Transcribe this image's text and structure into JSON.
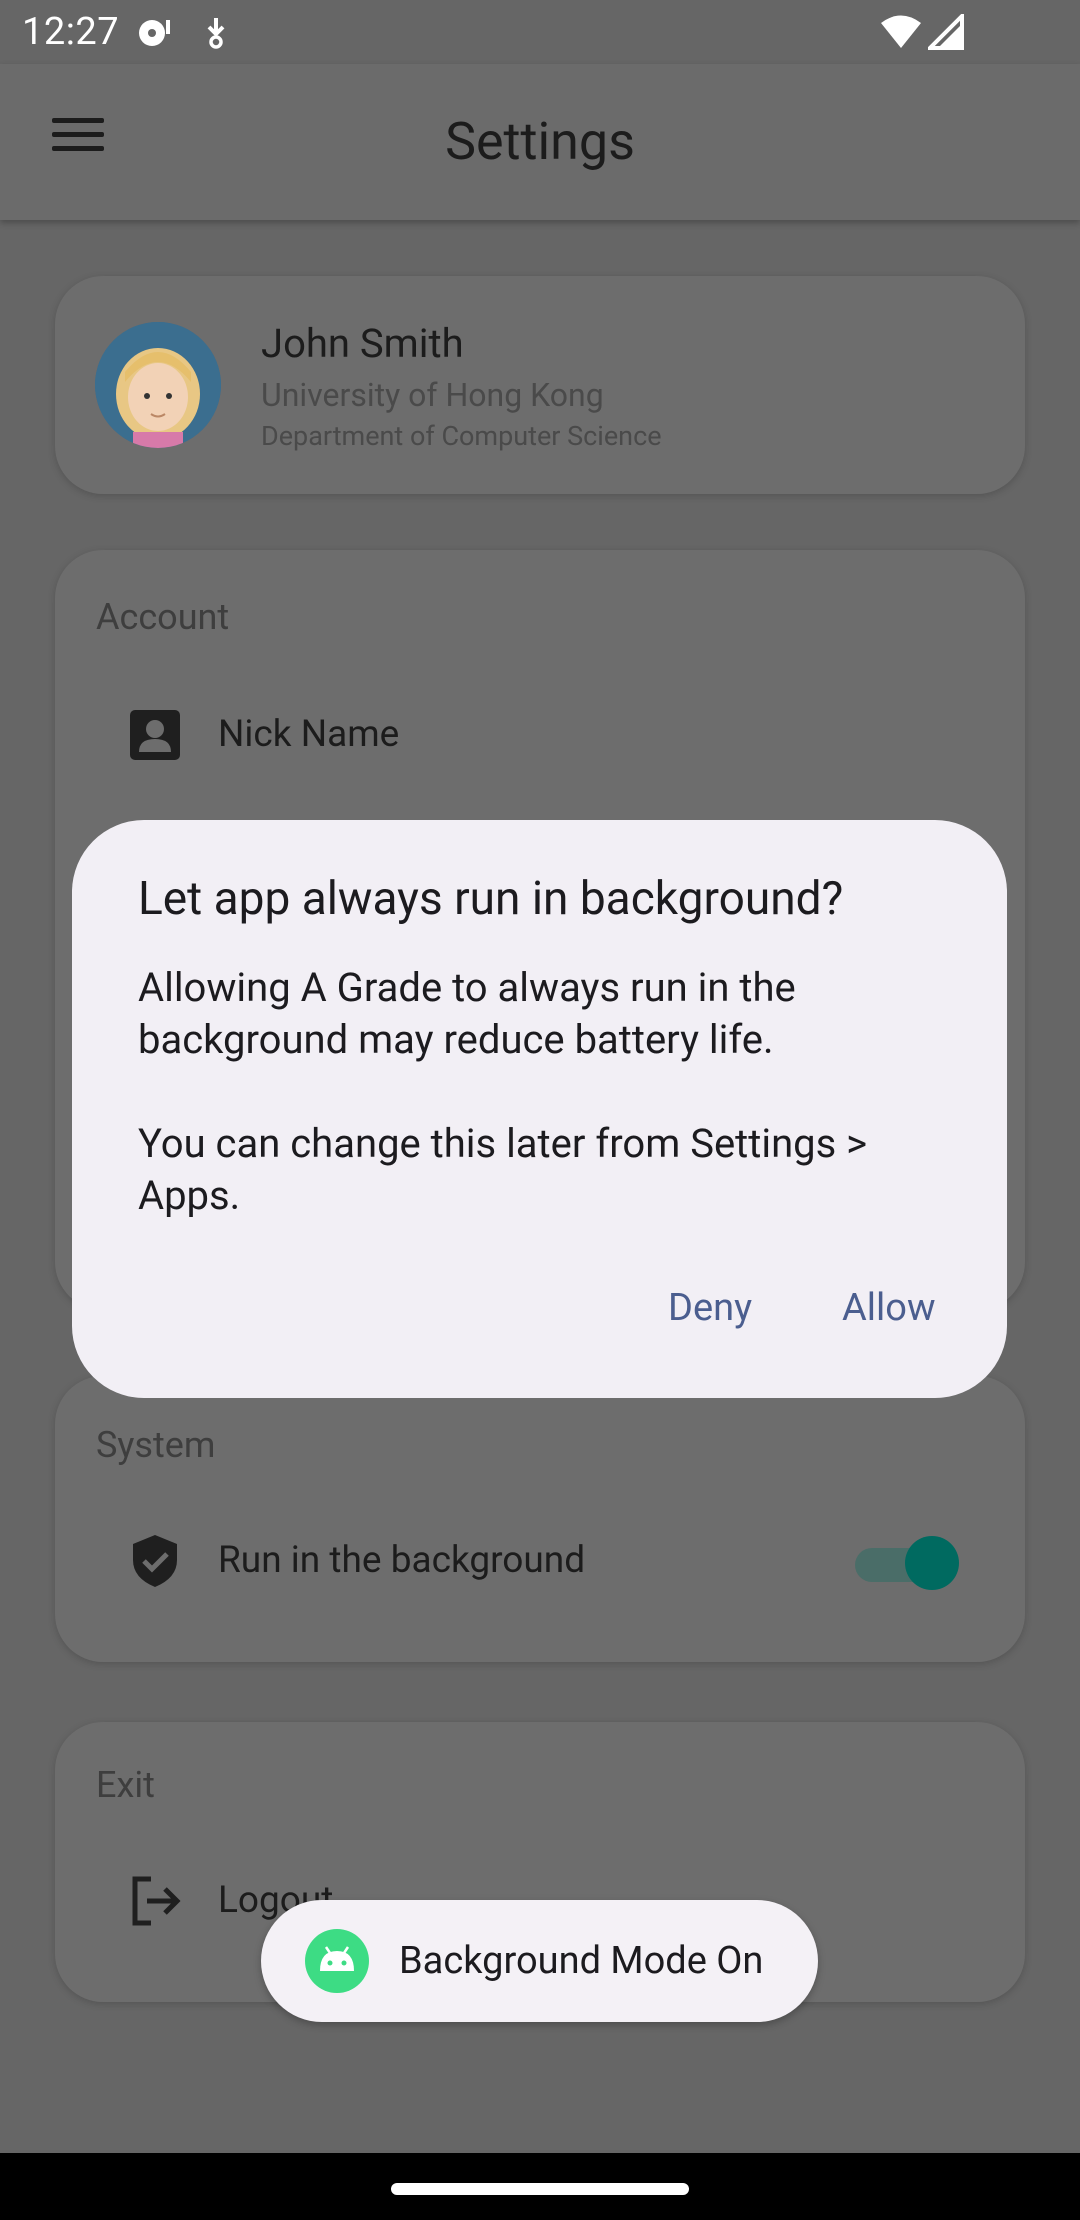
{
  "status_bar": {
    "time": "12:27",
    "icons": [
      "media-icon",
      "download-icon",
      "wifi-icon",
      "signal-icon"
    ]
  },
  "app_bar": {
    "title": "Settings",
    "menu_icon": "hamburger-menu-icon"
  },
  "profile": {
    "name": "John Smith",
    "university": "University of Hong Kong",
    "department": "Department of Computer Science"
  },
  "sections": {
    "account": {
      "title": "Account",
      "items": [
        {
          "label": "Nick Name",
          "icon": "person-icon"
        }
      ]
    },
    "system": {
      "title": "System",
      "items": [
        {
          "label": "Run in the background",
          "icon": "shield-check-icon",
          "toggle_on": true
        }
      ]
    },
    "exit": {
      "title": "Exit",
      "items": [
        {
          "label": "Logout",
          "icon": "logout-icon"
        }
      ]
    }
  },
  "dialog": {
    "title": "Let app always run in background?",
    "body": "Allowing A Grade to always run in the background may reduce battery life.\n\nYou can change this later from Settings > Apps.",
    "deny_label": "Deny",
    "allow_label": "Allow"
  },
  "toast": {
    "text": "Background Mode On",
    "icon": "android-icon"
  },
  "colors": {
    "scrim_background": "#666666",
    "dialog_surface": "#f2eff5",
    "button_text": "#4b5e8f",
    "toggle_on": "#006a60",
    "toast_icon_green": "#3ddc84"
  }
}
